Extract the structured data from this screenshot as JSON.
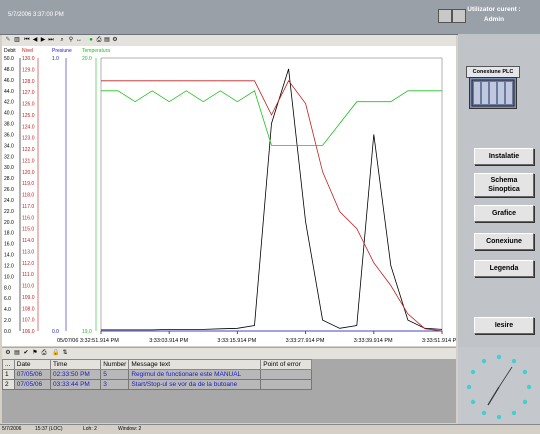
{
  "topbar": {
    "datetime": "5/7/2006 3:37:00 PM",
    "user_label": "Utilizator curent :",
    "user_name": "Admin"
  },
  "toolbar": {
    "prev_label": "<",
    "next_label": ">"
  },
  "chart_data": {
    "type": "line",
    "axes": [
      {
        "name": "Debit",
        "color": "#000000",
        "range": [
          0.0,
          50.0
        ],
        "ticks": [
          "50.0",
          "48.0",
          "46.0",
          "44.0",
          "42.0",
          "40.0",
          "38.0",
          "36.0",
          "34.0",
          "32.0",
          "30.0",
          "28.0",
          "26.0",
          "24.0",
          "22.0",
          "20.0",
          "18.0",
          "16.0",
          "14.0",
          "12.0",
          "10.0",
          "8.0",
          "6.0",
          "4.0",
          "2.0",
          "0.0"
        ]
      },
      {
        "name": "Nivel",
        "color": "#c02020",
        "range": [
          106.0,
          130.0
        ],
        "ticks": [
          "130.0",
          "129.0",
          "128.0",
          "127.0",
          "126.0",
          "125.0",
          "124.0",
          "123.0",
          "122.0",
          "121.0",
          "120.0",
          "119.0",
          "118.0",
          "117.0",
          "116.0",
          "115.0",
          "114.0",
          "113.0",
          "112.0",
          "111.0",
          "110.0",
          "109.0",
          "108.0",
          "107.0",
          "106.0"
        ]
      },
      {
        "name": "Presiune",
        "color": "#2020c0",
        "range": [
          0.0,
          1.0
        ],
        "ticks": [
          "1.0",
          "0.0"
        ]
      },
      {
        "name": "Temperatura",
        "color": "#20c020",
        "range": [
          19.0,
          20.0
        ],
        "ticks": [
          "20.0",
          "19.0"
        ]
      }
    ],
    "x_ticks": [
      "05/07/06 3:32:51.914 PM",
      "3:33:03.914 PM",
      "3:33:15.914 PM",
      "3:33:27.914 PM",
      "3:33:39.914 PM",
      "3:33:51.914 PM"
    ],
    "x": [
      0,
      3,
      6,
      9,
      12,
      15,
      18,
      21,
      24,
      27,
      30,
      33,
      36,
      39,
      42,
      45,
      48,
      51,
      54,
      57,
      60
    ],
    "series": [
      {
        "name": "Debit",
        "color": "#000000",
        "values": [
          0.2,
          0.2,
          0.2,
          0.2,
          0.3,
          0.3,
          0.3,
          0.4,
          0.5,
          1.0,
          38.0,
          48.0,
          20.0,
          2.0,
          0.5,
          1.0,
          36.0,
          12.0,
          2.0,
          0.5,
          0.3
        ]
      },
      {
        "name": "Nivel",
        "color": "#c02020",
        "values": [
          128.0,
          128.0,
          128.0,
          128.0,
          128.0,
          128.0,
          128.0,
          128.0,
          128.0,
          128.0,
          125.0,
          128.0,
          126.0,
          120.0,
          116.5,
          115.0,
          112.0,
          110.0,
          107.5,
          106.2,
          106.0
        ]
      },
      {
        "name": "Presiune",
        "color": "#2020c0",
        "values": [
          0.0,
          0.0,
          0.0,
          0.0,
          0.0,
          0.0,
          0.0,
          0.0,
          0.0,
          0.0,
          0.0,
          0.0,
          0.0,
          0.0,
          0.0,
          0.0,
          0.0,
          0.0,
          0.0,
          0.0,
          0.0
        ]
      },
      {
        "name": "Temperatura",
        "color": "#20c020",
        "values": [
          44.0,
          44.0,
          42.0,
          44.0,
          42.0,
          44.0,
          42.0,
          44.0,
          42.0,
          44.0,
          34.0,
          34.0,
          34.0,
          34.0,
          38.0,
          42.0,
          42.0,
          42.0,
          44.0,
          44.0,
          44.0
        ]
      }
    ]
  },
  "plc": {
    "label": "Conexiune PLC"
  },
  "nav": [
    {
      "label": "Instalatie"
    },
    {
      "label": "Schema Sinoptica"
    },
    {
      "label": "Grafice"
    },
    {
      "label": "Conexiune"
    },
    {
      "label": "Legenda"
    },
    {
      "label": "Iesire"
    }
  ],
  "messages": {
    "columns": [
      "...",
      "Date",
      "Time",
      "Number",
      "Message text",
      "Point of error"
    ],
    "rows": [
      {
        "idx": "1",
        "date": "07/05/06",
        "time": "02:33:50 PM",
        "number": "5",
        "text": "Regimul de functionare este MANUAL",
        "poe": ""
      },
      {
        "idx": "2",
        "date": "07/05/06",
        "time": "03:33:44 PM",
        "number": "3",
        "text": "Start/Stop-ul se vor da de la butoane",
        "poe": ""
      }
    ]
  },
  "status": {
    "s1": "5/7/2006",
    "s2": "15:37 (LOC)",
    "s3": "Loh: 2",
    "s4": "Window: 2"
  }
}
